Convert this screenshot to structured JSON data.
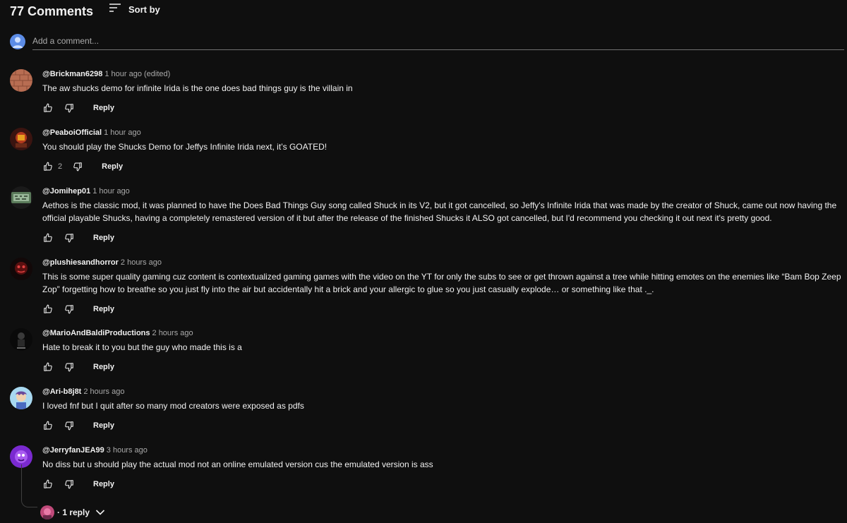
{
  "header": {
    "comment_count": "77 Comments",
    "sort_label": "Sort by"
  },
  "add_comment": {
    "placeholder": "Add a comment..."
  },
  "comments": [
    {
      "author": "@Brickman6298",
      "time": "1 hour ago (edited)",
      "text": "The aw shucks demo for infinite Irida is the one does bad things guy is the villain in",
      "likes": "",
      "reply_label": "Reply"
    },
    {
      "author": "@PeaboiOfficial",
      "time": "1 hour ago",
      "text": "You should play the Shucks Demo for Jeffys Infinite Irida next, it’s GOATED!",
      "likes": "2",
      "reply_label": "Reply"
    },
    {
      "author": "@Jomihep01",
      "time": "1 hour ago",
      "text": "Aethos is the classic mod, it was planned to have the Does Bad Things Guy song called Shuck in its V2, but it got cancelled, so Jeffy's Infinite Irida that was made by the creator of Shuck, came out now having the official playable Shucks, having a completely remastered version of it but after the release of the finished Shucks it ALSO got cancelled, but I'd recommend you checking it out next it's pretty good.",
      "likes": "",
      "reply_label": "Reply"
    },
    {
      "author": "@plushiesandhorror",
      "time": "2 hours ago",
      "text": "This is some super quality gaming cuz content is contextualized gaming games with the video on the YT for only the subs to see or get thrown against a tree while hitting emotes on the enemies like “Bam Bop Zeep Zop” forgetting how to breathe so you just fly into the air but accidentally hit a brick and your allergic to glue so you just casually explode… or something like that ._.",
      "likes": "",
      "reply_label": "Reply"
    },
    {
      "author": "@MarioAndBaldiProductions",
      "time": "2 hours ago",
      "text": "Hate to break it to you but the guy who made this is a",
      "likes": "",
      "reply_label": "Reply"
    },
    {
      "author": "@Ari-b8j8t",
      "time": "2 hours ago",
      "text": "I loved fnf but I quit after so many mod creators were exposed as pdfs",
      "likes": "",
      "reply_label": "Reply"
    },
    {
      "author": "@JerryfanJEA99",
      "time": "3 hours ago",
      "text": "No diss but u should play the actual mod not an online emulated version cus the emulated version is ass",
      "likes": "",
      "reply_label": "Reply"
    }
  ],
  "replies_toggle": {
    "label": "· 1 reply"
  },
  "icons": {
    "sort": "sort-icon",
    "like": "thumbs-up-icon",
    "dislike": "thumbs-down-icon",
    "expand": "chevron-down-icon"
  },
  "colors": {
    "background": "#0f0f0f",
    "text": "#f1f1f1",
    "secondary_text": "#aaaaaa",
    "divider": "#717171"
  }
}
